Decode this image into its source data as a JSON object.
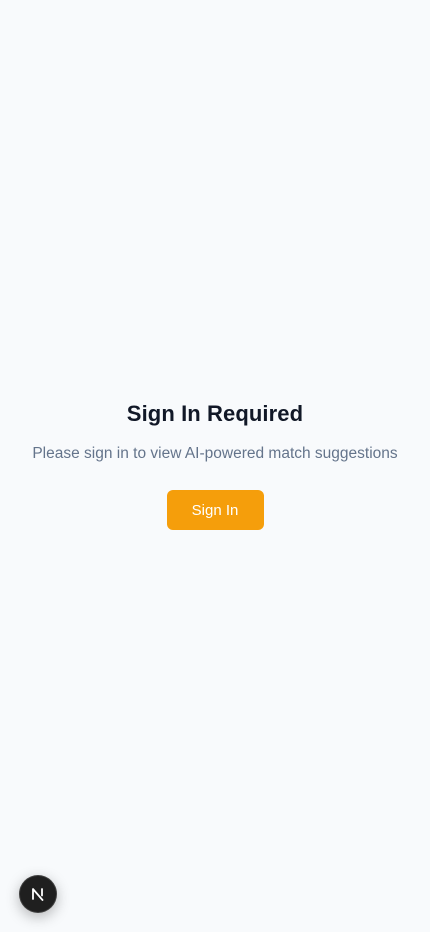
{
  "auth": {
    "title": "Sign In Required",
    "message": "Please sign in to view AI-powered match suggestions",
    "button_label": "Sign In"
  },
  "dev_indicator": {
    "icon": "nextjs-logo-icon",
    "letter": "N"
  },
  "colors": {
    "background": "#f8fafc",
    "title": "#111827",
    "message": "#64748b",
    "button": "#f59e0b",
    "button_text": "#ffffff",
    "badge": "#1f1f1f"
  }
}
